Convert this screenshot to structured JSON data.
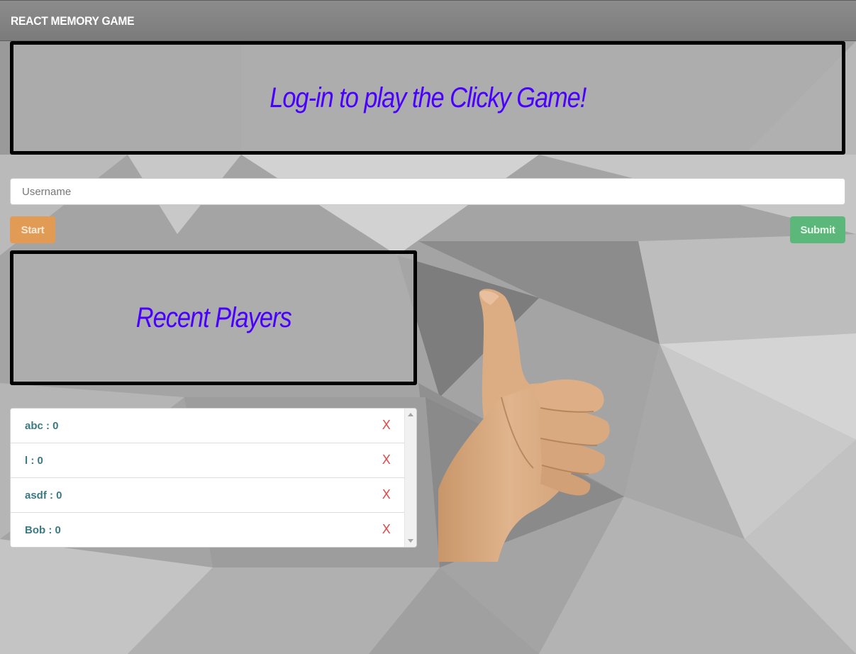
{
  "navbar": {
    "brand": "REACT MEMORY GAME"
  },
  "hero": {
    "title": "Log-in to play the Clicky Game!"
  },
  "login": {
    "username_placeholder": "Username",
    "username_value": "",
    "start_label": "Start",
    "submit_label": "Submit"
  },
  "recent": {
    "title": "Recent Players",
    "players": [
      {
        "label": "abc : 0",
        "delete_label": "X"
      },
      {
        "label": "l : 0",
        "delete_label": "X"
      },
      {
        "label": "asdf : 0",
        "delete_label": "X"
      },
      {
        "label": "Bob : 0",
        "delete_label": "X"
      }
    ]
  },
  "image": {
    "icon": "thumbs-up-hand-icon"
  },
  "colors": {
    "heading": "#4a00ff",
    "start_button": "#e29b55",
    "submit_button": "#5cb87a",
    "player_name": "#3a7a80",
    "delete": "#e05050"
  }
}
